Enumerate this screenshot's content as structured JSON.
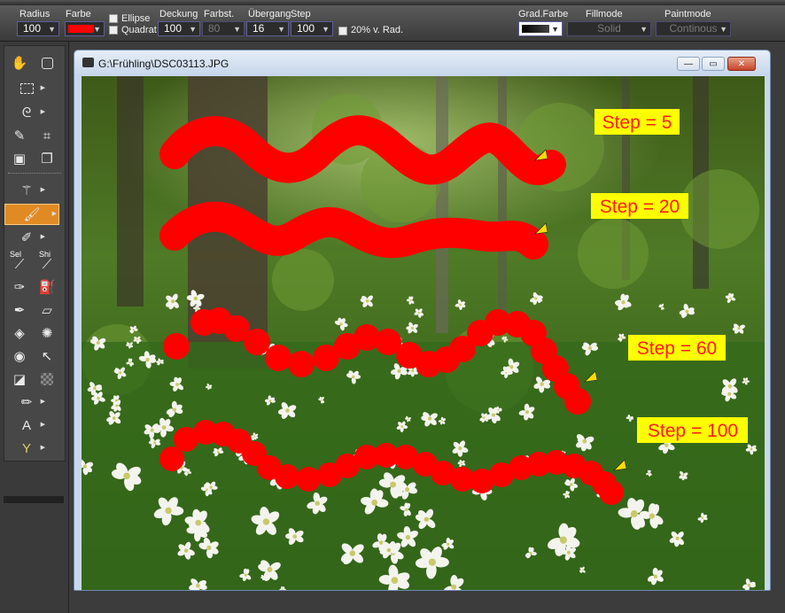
{
  "options": {
    "radius_label": "Radius",
    "radius_value": "100",
    "farbe_label": "Farbe",
    "brush_color": "#ff0000",
    "ellipse_label": "Ellipse",
    "quadrat_label": "Quadrat",
    "deckung_label": "Deckung",
    "deckung_value": "100",
    "farbst_label": "Farbst.",
    "farbst_value": "80",
    "uebergang_label": "Übergang",
    "uebergang_value": "16",
    "step_label": "Step",
    "step_value": "100",
    "rad_label": "20% v. Rad.",
    "gradfarbe_label": "Grad.Farbe",
    "fillmode_label": "Fillmode",
    "fillmode_value": "Solid",
    "paintmode_label": "Paintmode",
    "paintmode_value": "Continous"
  },
  "tools": {
    "sel_label_1": "Sel",
    "sel_label_2": "Shi"
  },
  "document": {
    "title": "G:\\Frühling\\DSC03113.JPG"
  },
  "annotations": [
    {
      "text": "Step = 5"
    },
    {
      "text": "Step = 20"
    },
    {
      "text": "Step = 60"
    },
    {
      "text": "Step = 100"
    }
  ],
  "colors": {
    "stroke": "#ff0000",
    "label_bg": "#ffff00",
    "marker": "#ffdd00"
  }
}
